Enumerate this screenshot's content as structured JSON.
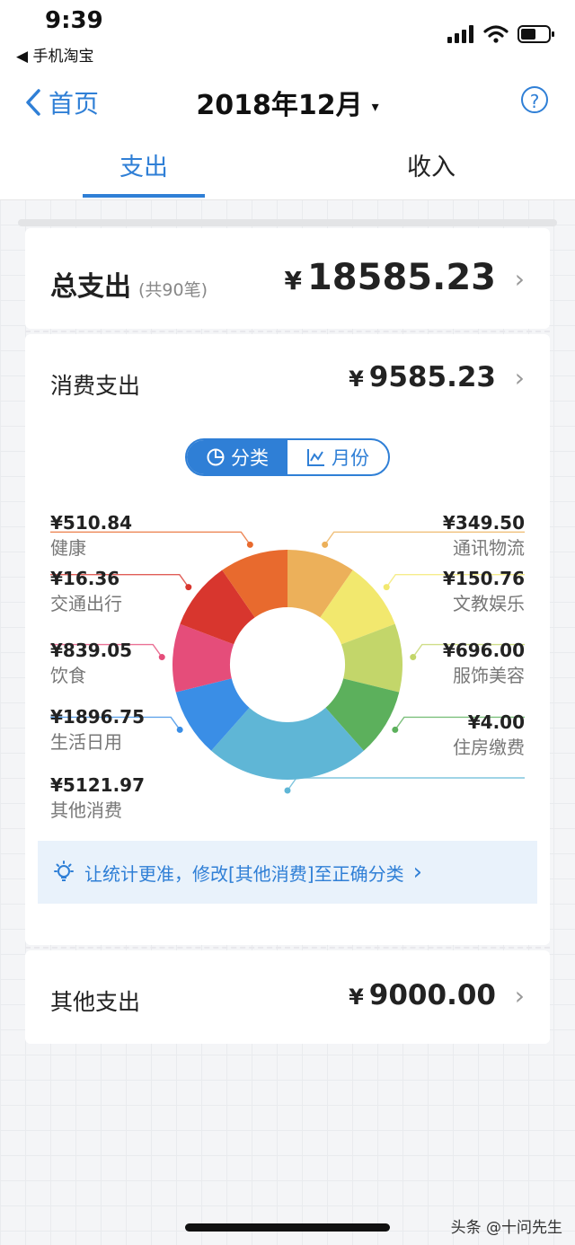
{
  "status": {
    "time": "9:39",
    "back_app": "◀ 手机淘宝"
  },
  "nav": {
    "back_label": "首页",
    "title": "2018年12月",
    "caret": "▾",
    "help": "?"
  },
  "tabs": [
    {
      "label": "支出"
    },
    {
      "label": "收入"
    }
  ],
  "total": {
    "title": "总支出",
    "count": "(共90笔)",
    "currency": "¥",
    "amount": "18585.23"
  },
  "consumption": {
    "title": "消费支出",
    "currency": "¥",
    "amount": "9585.23"
  },
  "toggle": {
    "category": "分类",
    "month": "月份"
  },
  "categories": [
    {
      "name": "健康",
      "amount": "¥510.84",
      "color": "#e86a2e"
    },
    {
      "name": "交通出行",
      "amount": "¥16.36",
      "color": "#d8362e"
    },
    {
      "name": "饮食",
      "amount": "¥839.05",
      "color": "#e54d7a"
    },
    {
      "name": "生活日用",
      "amount": "¥1896.75",
      "color": "#3a8ee6"
    },
    {
      "name": "其他消费",
      "amount": "¥5121.97",
      "color": "#5fb6d6"
    },
    {
      "name": "通讯物流",
      "amount": "¥349.50",
      "color": "#ecb05a"
    },
    {
      "name": "文教娱乐",
      "amount": "¥150.76",
      "color": "#f2e86e"
    },
    {
      "name": "服饰美容",
      "amount": "¥696.00",
      "color": "#c3d66a"
    },
    {
      "name": "住房缴费",
      "amount": "¥4.00",
      "color": "#5cb05c"
    }
  ],
  "tip": {
    "text": "让统计更准，修改[其他消费]至正确分类"
  },
  "other": {
    "title": "其他支出",
    "currency": "¥",
    "amount": "9000.00"
  },
  "watermark": "头条 @十问先生",
  "chart_data": {
    "type": "pie",
    "categories": [
      "通讯物流",
      "文教娱乐",
      "服饰美容",
      "住房缴费",
      "其他消费",
      "生活日用",
      "饮食",
      "交通出行",
      "健康"
    ],
    "values": [
      349.5,
      150.76,
      696.0,
      4.0,
      5121.97,
      1896.75,
      839.05,
      16.36,
      510.84
    ],
    "colors": [
      "#ecb05a",
      "#f2e86e",
      "#c3d66a",
      "#5cb05c",
      "#5fb6d6",
      "#3a8ee6",
      "#e54d7a",
      "#d8362e",
      "#e86a2e"
    ]
  }
}
